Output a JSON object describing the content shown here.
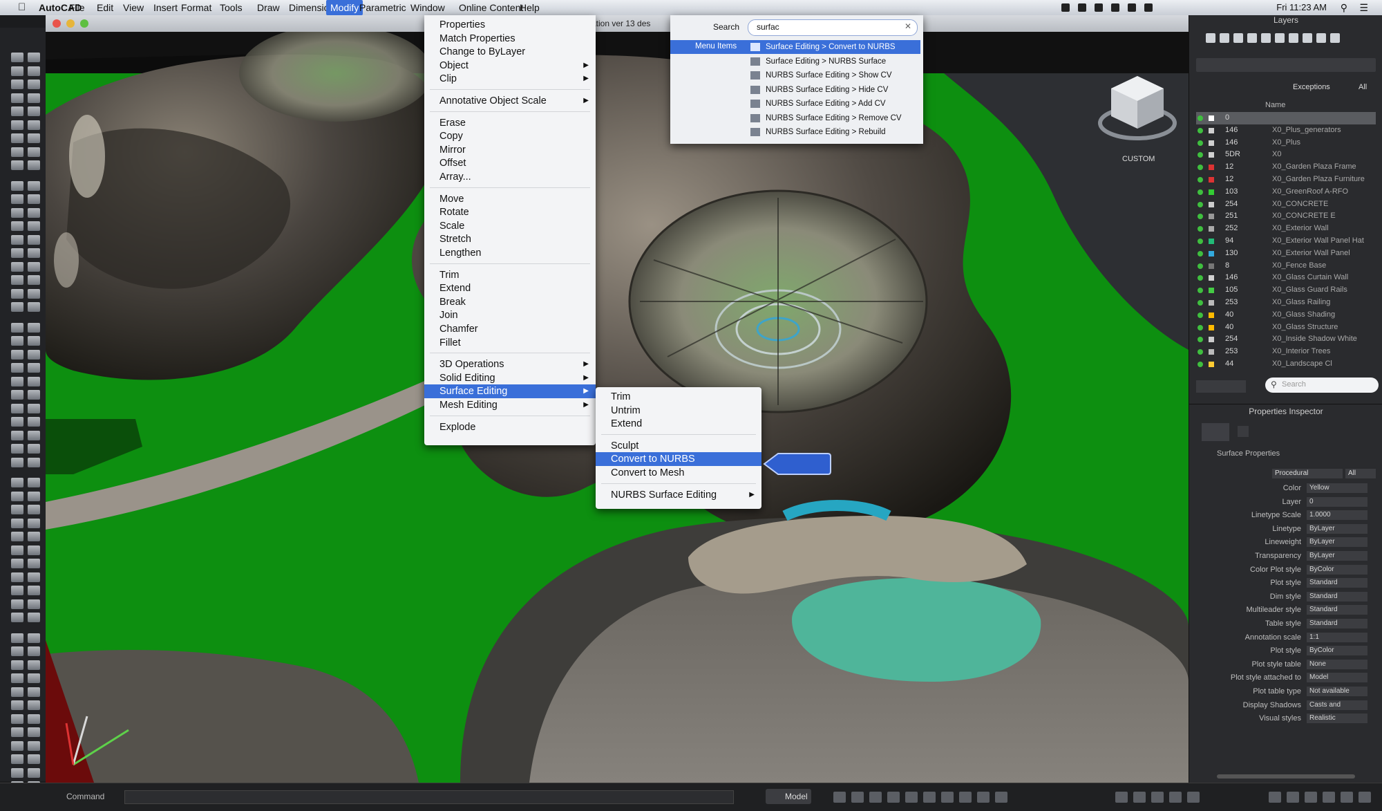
{
  "app": {
    "name": "AutoCAD",
    "menubar": [
      "File",
      "Edit",
      "View",
      "Insert",
      "Format",
      "Tools",
      "Draw",
      "Dimension",
      "Modify",
      "Parametric",
      "Window",
      "Online Content",
      "Help"
    ],
    "active_menu": "Modify",
    "clock": "Fri 11:23 AM"
  },
  "window": {
    "title": "ation ver 13 des"
  },
  "modify_menu": {
    "items": [
      {
        "label": "Properties",
        "sub": false
      },
      {
        "label": "Match Properties",
        "sub": false
      },
      {
        "label": "Change to ByLayer",
        "sub": false
      },
      {
        "label": "Object",
        "sub": true
      },
      {
        "label": "Clip",
        "sub": true
      },
      {
        "sep": true
      },
      {
        "label": "Annotative Object Scale",
        "sub": true
      },
      {
        "sep": true
      },
      {
        "label": "Erase",
        "sub": false
      },
      {
        "label": "Copy",
        "sub": false
      },
      {
        "label": "Mirror",
        "sub": false
      },
      {
        "label": "Offset",
        "sub": false
      },
      {
        "label": "Array...",
        "sub": false
      },
      {
        "sep": true
      },
      {
        "label": "Move",
        "sub": false
      },
      {
        "label": "Rotate",
        "sub": false
      },
      {
        "label": "Scale",
        "sub": false
      },
      {
        "label": "Stretch",
        "sub": false
      },
      {
        "label": "Lengthen",
        "sub": false
      },
      {
        "sep": true
      },
      {
        "label": "Trim",
        "sub": false
      },
      {
        "label": "Extend",
        "sub": false
      },
      {
        "label": "Break",
        "sub": false
      },
      {
        "label": "Join",
        "sub": false
      },
      {
        "label": "Chamfer",
        "sub": false
      },
      {
        "label": "Fillet",
        "sub": false
      },
      {
        "sep": true
      },
      {
        "label": "3D Operations",
        "sub": true
      },
      {
        "label": "Solid Editing",
        "sub": true
      },
      {
        "label": "Surface Editing",
        "sub": true,
        "hl": true
      },
      {
        "label": "Mesh Editing",
        "sub": true
      },
      {
        "sep": true
      },
      {
        "label": "Explode",
        "sub": false
      }
    ]
  },
  "surface_menu": {
    "items": [
      {
        "label": "Trim"
      },
      {
        "label": "Untrim"
      },
      {
        "label": "Extend"
      },
      {
        "sep": true
      },
      {
        "label": "Sculpt"
      },
      {
        "label": "Convert to NURBS",
        "hl": true
      },
      {
        "label": "Convert to Mesh"
      },
      {
        "sep": true
      },
      {
        "label": "NURBS Surface Editing",
        "sub": true
      }
    ]
  },
  "help_search": {
    "label": "Search",
    "query": "surfac",
    "category": "Menu Items",
    "results": [
      "Surface Editing > Convert to NURBS",
      "Surface Editing > NURBS Surface",
      "NURBS Surface Editing > Show CV",
      "NURBS Surface Editing > Hide CV",
      "NURBS Surface Editing > Add CV",
      "NURBS Surface Editing > Remove CV",
      "NURBS Surface Editing > Rebuild"
    ]
  },
  "viewcube": {
    "label": "CUSTOM"
  },
  "layers_panel": {
    "title": "Layers",
    "count_label": "Exceptions",
    "count_value": "All",
    "column_name": "Name",
    "search_placeholder": "Search",
    "rows": [
      {
        "name": "0",
        "desc": "",
        "color": "#ffffff"
      },
      {
        "name": "146",
        "desc": "X0_Plus_generators",
        "color": "#d0d0d0"
      },
      {
        "name": "146",
        "desc": "X0_Plus",
        "color": "#d0d0d0"
      },
      {
        "name": "5DR",
        "desc": "X0",
        "color": "#d0d0d0"
      },
      {
        "name": "12",
        "desc": "X0_Garden Plaza Frame",
        "color": "#d33"
      },
      {
        "name": "12",
        "desc": "X0_Garden Plaza Furniture",
        "color": "#d33"
      },
      {
        "name": "103",
        "desc": "X0_GreenRoof A-RFO",
        "color": "#3c3"
      },
      {
        "name": "254",
        "desc": "X0_CONCRETE",
        "color": "#ccc"
      },
      {
        "name": "251",
        "desc": "X0_CONCRETE E",
        "color": "#999"
      },
      {
        "name": "252",
        "desc": "X0_Exterior Wall",
        "color": "#aaa"
      },
      {
        "name": "94",
        "desc": "X0_Exterior Wall Panel Hat",
        "color": "#2b7"
      },
      {
        "name": "130",
        "desc": "X0_Exterior Wall Panel",
        "color": "#3ad"
      },
      {
        "name": "8",
        "desc": "X0_Fence Base",
        "color": "#777"
      },
      {
        "name": "146",
        "desc": "X0_Glass Curtain Wall",
        "color": "#d0d0d0"
      },
      {
        "name": "105",
        "desc": "X0_Glass Guard Rails",
        "color": "#4c4"
      },
      {
        "name": "253",
        "desc": "X0_Glass Railing",
        "color": "#bbb"
      },
      {
        "name": "40",
        "desc": "X0_Glass Shading",
        "color": "#fb0"
      },
      {
        "name": "40",
        "desc": "X0_Glass Structure",
        "color": "#fb0"
      },
      {
        "name": "254",
        "desc": "X0_Inside Shadow White",
        "color": "#ccc"
      },
      {
        "name": "253",
        "desc": "X0_Interior Trees",
        "color": "#bbb"
      },
      {
        "name": "44",
        "desc": "X0_Landscape Cl",
        "color": "#fc3"
      }
    ]
  },
  "properties_panel": {
    "title": "Properties Inspector",
    "section": "Surface Properties",
    "type_value": "Procedural",
    "type_extra": "All",
    "rows": [
      {
        "label": "Color",
        "value": "Yellow"
      },
      {
        "label": "Layer",
        "value": "0"
      },
      {
        "label": "Linetype Scale",
        "value": "1.0000"
      },
      {
        "label": "Linetype",
        "value": "ByLayer"
      },
      {
        "label": "Lineweight",
        "value": "ByLayer"
      },
      {
        "label": "Transparency",
        "value": "ByLayer"
      },
      {
        "label": "Color Plot style",
        "value": "ByColor"
      },
      {
        "label": "Plot style",
        "value": "Standard"
      },
      {
        "label": "Dim style",
        "value": "Standard"
      },
      {
        "label": "Multileader style",
        "value": "Standard"
      },
      {
        "label": "Table style",
        "value": "Standard"
      },
      {
        "label": "Annotation scale",
        "value": "1:1"
      },
      {
        "label": "Plot style",
        "value": "ByColor"
      },
      {
        "label": "Plot style table",
        "value": "None"
      },
      {
        "label": "Plot style attached to",
        "value": "Model"
      },
      {
        "label": "Plot table type",
        "value": "Not available"
      },
      {
        "label": "Display Shadows",
        "value": "Casts and"
      },
      {
        "label": "Visual styles",
        "value": "Realistic"
      }
    ]
  },
  "status": {
    "command_label": "Command",
    "model_label": "Model"
  }
}
